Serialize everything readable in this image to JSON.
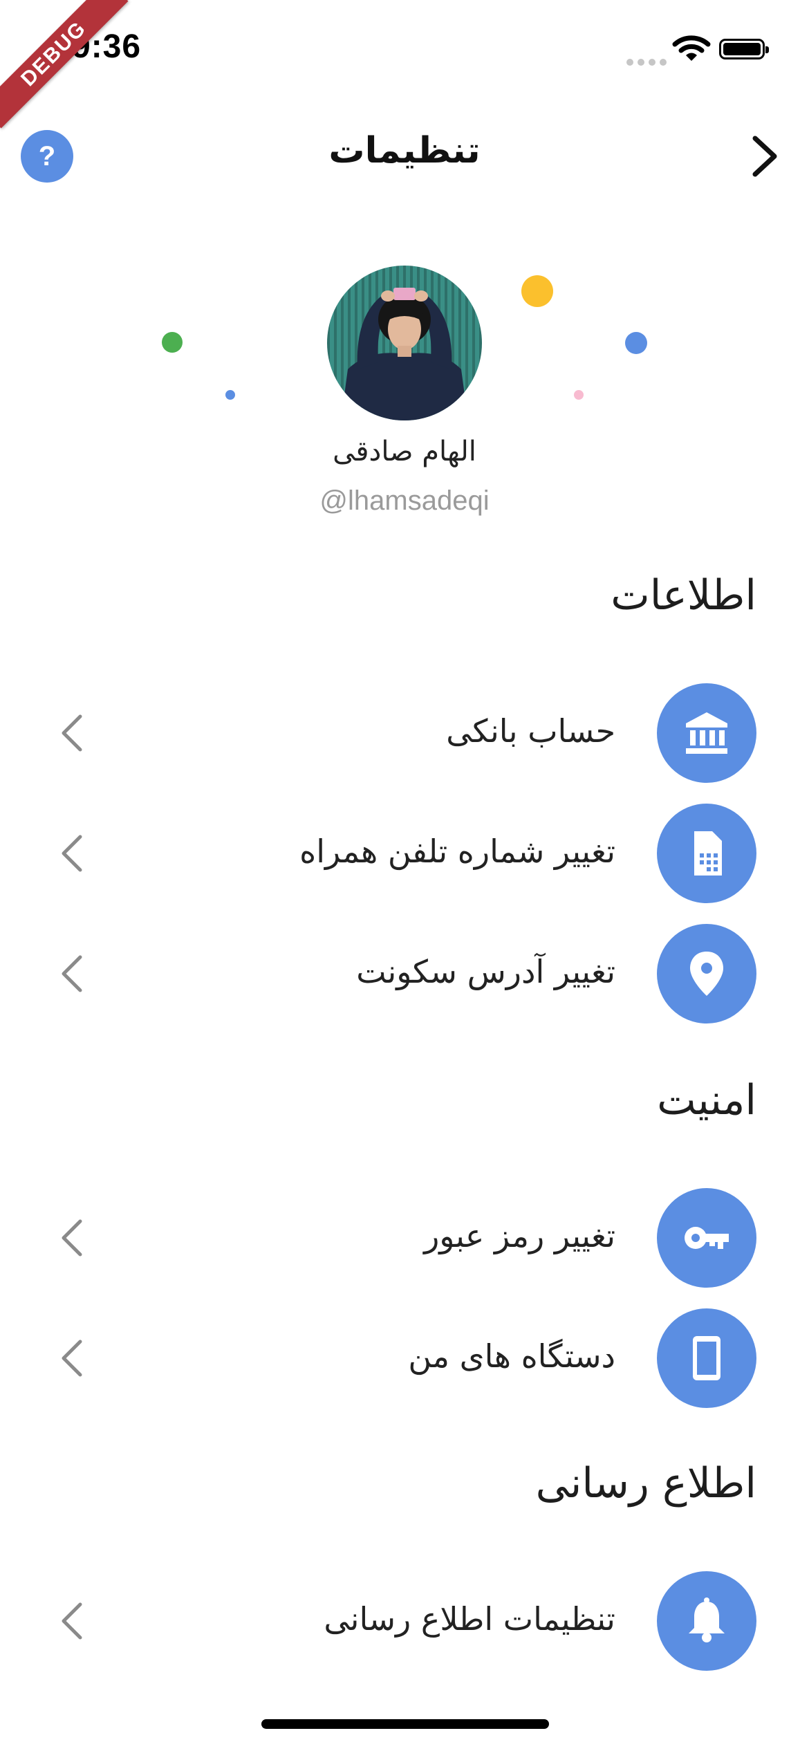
{
  "status_bar": {
    "time": "9:36"
  },
  "debug_banner": {
    "label": "DEBUG"
  },
  "header": {
    "title": "تنظیمات",
    "help_label": "?"
  },
  "profile": {
    "name": "الهام صادقی",
    "handle": "@lhamsadeqi"
  },
  "sections": [
    {
      "title": "اطلاعات",
      "items": [
        {
          "label": "حساب بانکی",
          "icon": "bank-icon"
        },
        {
          "label": "تغییر شماره تلفن همراه",
          "icon": "sim-card-icon"
        },
        {
          "label": "تغییر آدرس سکونت",
          "icon": "location-pin-icon"
        }
      ]
    },
    {
      "title": "امنیت",
      "items": [
        {
          "label": "تغییر رمز عبور",
          "icon": "key-icon"
        },
        {
          "label": "دستگاه های من",
          "icon": "phone-device-icon"
        }
      ]
    },
    {
      "title": "اطلاع رسانی",
      "items": [
        {
          "label": "تنظیمات اطلاع رسانی",
          "icon": "bell-icon"
        }
      ]
    }
  ],
  "colors": {
    "accent": "#5b8ee2",
    "dot_green": "#4caf50",
    "dot_yellow": "#fbc02d",
    "dot_blue": "#5b8ee2",
    "dot_pink": "#f8bbd0",
    "debug_red": "#b3333a"
  }
}
